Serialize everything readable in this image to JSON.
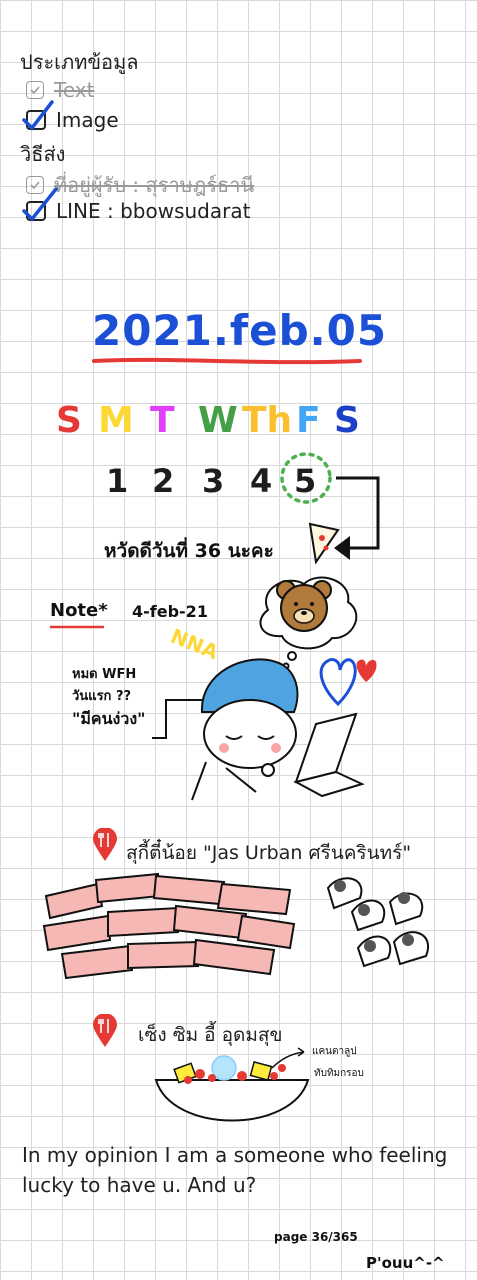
{
  "checklist": {
    "data_type_heading": "ประเภทข้อมูล",
    "data_type_options": [
      {
        "label": "Text",
        "checked": false,
        "struck": true
      },
      {
        "label": "Image",
        "checked": true,
        "struck": false
      }
    ],
    "method_heading": "วิธีส่ง",
    "method_options": [
      {
        "label": "ที่อยู่ผู้รับ : สุราษฎร์ธานี",
        "checked": false,
        "struck": true
      },
      {
        "label": "LINE : bbowsudarat",
        "checked": true,
        "struck": false
      }
    ]
  },
  "journal": {
    "date_title": "2021.feb.05",
    "weekdays": [
      {
        "label": "S",
        "color": "#e53935"
      },
      {
        "label": "M",
        "color": "#fdd835"
      },
      {
        "label": "T",
        "color": "#e040fb"
      },
      {
        "label": "W",
        "color": "#43a047"
      },
      {
        "label": "Th",
        "color": "#fbc02d"
      },
      {
        "label": "F",
        "color": "#42a5f5"
      },
      {
        "label": "S",
        "color": "#1e40c8"
      }
    ],
    "days": [
      "1",
      "2",
      "3",
      "4",
      "5"
    ],
    "highlighted_day": "5",
    "holiday_note": "หวัดดีวันที่ 36 นะคะ",
    "note_label": "Note*",
    "note_date": "4-feb-21",
    "zzz_text": "NNA",
    "wfh_lines": [
      "หมด WFH",
      "วันแรก ??",
      "\"มีคนง่วง\""
    ],
    "place_1": "สุกี้ตี๋น้อย \"Jas Urban ศรีนครินทร์\"",
    "place_2": "เซ็ง ซิม อี้ อุดมสุข",
    "bowl_labels": [
      "แคนตาลูป",
      "ทับทิมกรอบ"
    ],
    "opinion_text": "In my opinion I am a someone who feeling lucky to have u. And u?",
    "page_counter": "page 36/365",
    "signature": "P'ouu^-^"
  },
  "colors": {
    "ink_blue": "#1a4fd6",
    "underline_red": "#e53935",
    "pin_red": "#e53935",
    "grid": "#d9d9d9"
  },
  "icons": [
    "checkbox-icon",
    "checkmark-icon",
    "location-pin-icon",
    "fork-knife-icon",
    "bear-icon",
    "heart-icon",
    "pizza-icon",
    "arrow-icon"
  ]
}
